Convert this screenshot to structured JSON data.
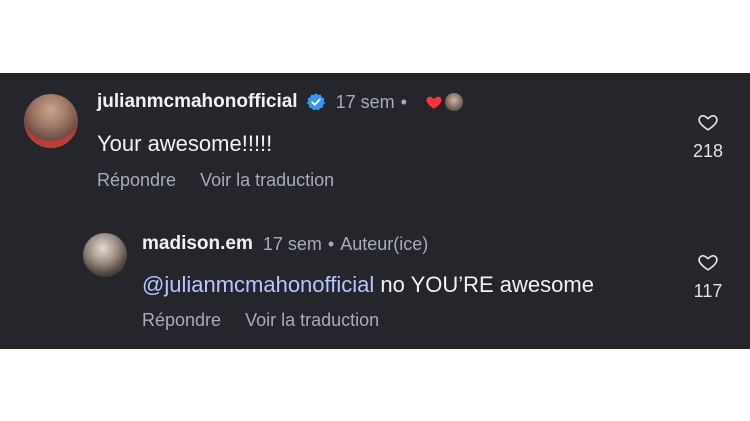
{
  "comments": [
    {
      "username": "julianmcmahonofficial",
      "verified": true,
      "time": "17 sem",
      "text": "Your awesome!!!!!",
      "reply_label": "Répondre",
      "translate_label": "Voir la traduction",
      "like_count": "218",
      "liked_by_author": true
    },
    {
      "username": "madison.em",
      "time": "17 sem",
      "author_badge": "Auteur(ice)",
      "mention": "@julianmcmahonofficial",
      "text": "no YOU’RE awesome",
      "reply_label": "Répondre",
      "translate_label": "Voir la traduction",
      "like_count": "117"
    }
  ],
  "colors": {
    "background": "#24262c",
    "text": "#f2f2f2",
    "muted": "#a9acb3",
    "mention": "#b8c6ff",
    "verified": "#3797f0",
    "heart": "#ff3040"
  },
  "icons": [
    "verified-icon",
    "heart-icon",
    "like-heart-icon"
  ]
}
